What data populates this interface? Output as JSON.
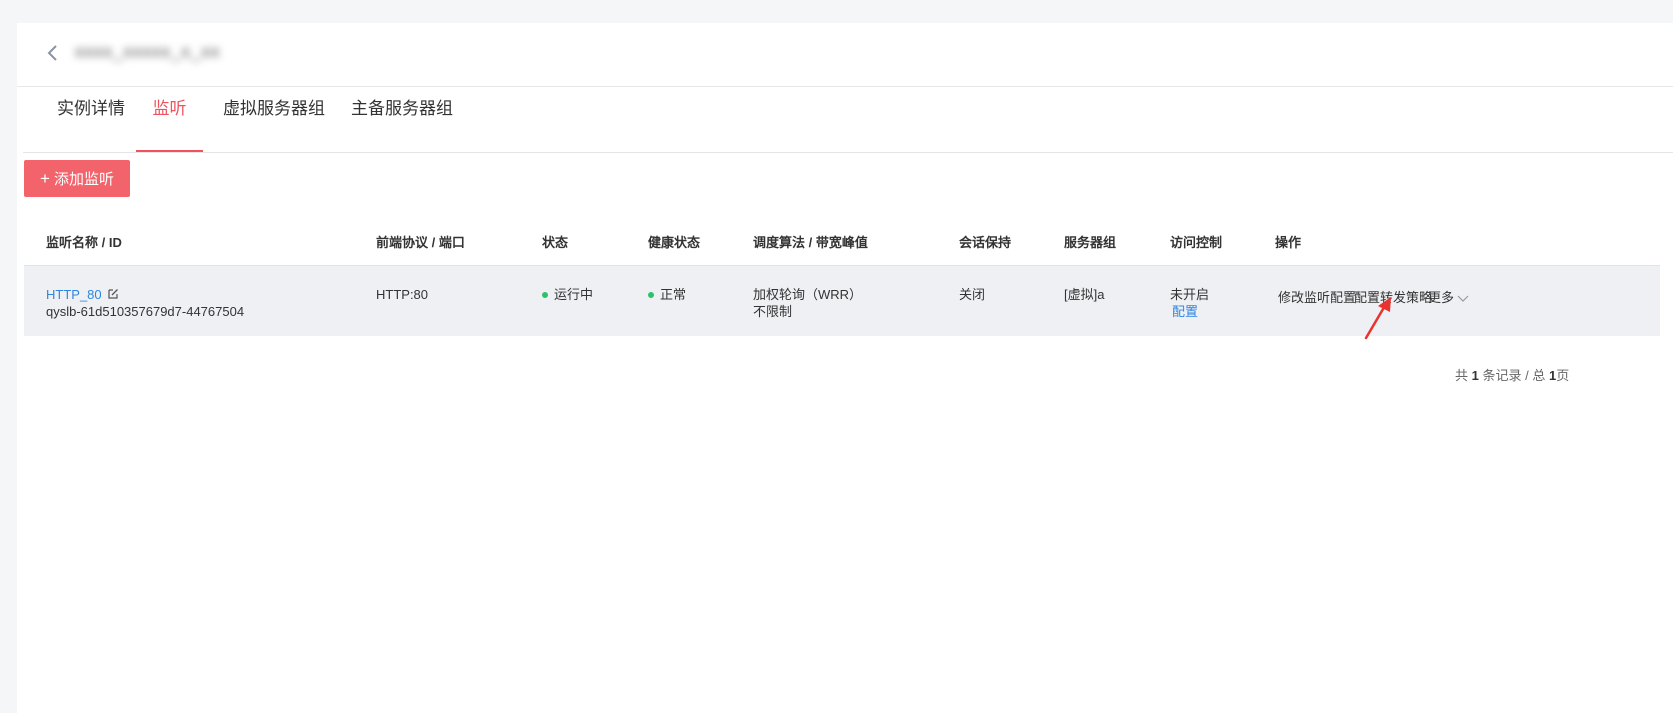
{
  "header": {
    "title_redacted": "xxxx_xxxxx_x_xx"
  },
  "tabs": [
    {
      "label": "实例详情",
      "active": false
    },
    {
      "label": "监听",
      "active": true
    },
    {
      "label": "虚拟服务器组",
      "active": false
    },
    {
      "label": "主备服务器组",
      "active": false
    }
  ],
  "toolbar": {
    "add_label": "添加监听"
  },
  "table": {
    "columns": [
      "监听名称 / ID",
      "前端协议 / 端口",
      "状态",
      "健康状态",
      "调度算法 / 带宽峰值",
      "会话保持",
      "服务器组",
      "访问控制",
      "操作"
    ],
    "rows": [
      {
        "name": "HTTP_80",
        "id": "qyslb-61d510357679d7-44767504",
        "protocol_port": "HTTP:80",
        "status": "运行中",
        "health": "正常",
        "algorithm": "加权轮询（WRR）",
        "bandwidth": "不限制",
        "session": "关闭",
        "server_group": "[虚拟]a",
        "access_control": "未开启",
        "access_config": "配置",
        "actions": {
          "modify": "修改监听配置",
          "forward": "配置转发策略",
          "more": "更多"
        }
      }
    ]
  },
  "pagination": {
    "prefix": "共",
    "total_records": "1",
    "records_mid": "条记录 / 总",
    "total_pages": "1",
    "pages_suffix": "页"
  },
  "colors": {
    "accent": "#f0535d",
    "button": "#f2636b",
    "link": "#2f86e0",
    "status_ok": "#2bc36a",
    "annotation_arrow": "#e8332f"
  }
}
